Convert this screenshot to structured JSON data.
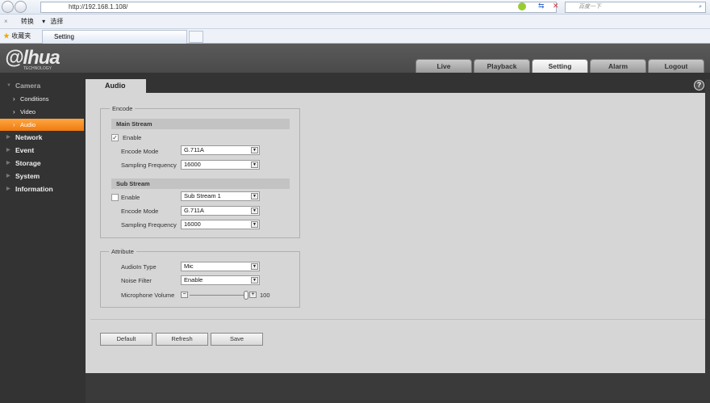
{
  "browser": {
    "url": "http://192.168.1.108/",
    "search_placeholder": "百度一下",
    "toolbar": {
      "convert": "转换",
      "select": "选择"
    },
    "favorites": "收藏夹",
    "tab_title": "Setting"
  },
  "header": {
    "logo": "alhua",
    "logo_sub": "TECHNOLOGY",
    "tabs": [
      {
        "label": "Live"
      },
      {
        "label": "Playback"
      },
      {
        "label": "Setting",
        "active": true
      },
      {
        "label": "Alarm"
      },
      {
        "label": "Logout"
      }
    ]
  },
  "sidebar": {
    "camera": "Camera",
    "sub": [
      "Conditions",
      "Video",
      "Audio"
    ],
    "items": [
      "Network",
      "Event",
      "Storage",
      "System",
      "Information"
    ]
  },
  "page": {
    "tab": "Audio",
    "help": "?"
  },
  "encode": {
    "legend": "Encode",
    "main": {
      "title": "Main Stream",
      "enable_label": "Enable",
      "enabled": true,
      "encode_mode_label": "Encode Mode",
      "encode_mode": "G.711A",
      "sampling_label": "Sampling Frequency",
      "sampling": "16000"
    },
    "sub": {
      "title": "Sub Stream",
      "enable_label": "Enable",
      "enabled": false,
      "stream": "Sub Stream 1",
      "encode_mode_label": "Encode Mode",
      "encode_mode": "G.711A",
      "sampling_label": "Sampling Frequency",
      "sampling": "16000"
    }
  },
  "attribute": {
    "legend": "Attribute",
    "audioin_label": "AudioIn Type",
    "audioin": "Mic",
    "noise_label": "Noise Filter",
    "noise": "Enable",
    "volume_label": "Microphone Volume",
    "volume": "100"
  },
  "buttons": {
    "default": "Default",
    "refresh": "Refresh",
    "save": "Save"
  },
  "colors": {
    "accent": "#f58a1f",
    "sidebar": "#333333",
    "content": "#d6d6d6"
  }
}
